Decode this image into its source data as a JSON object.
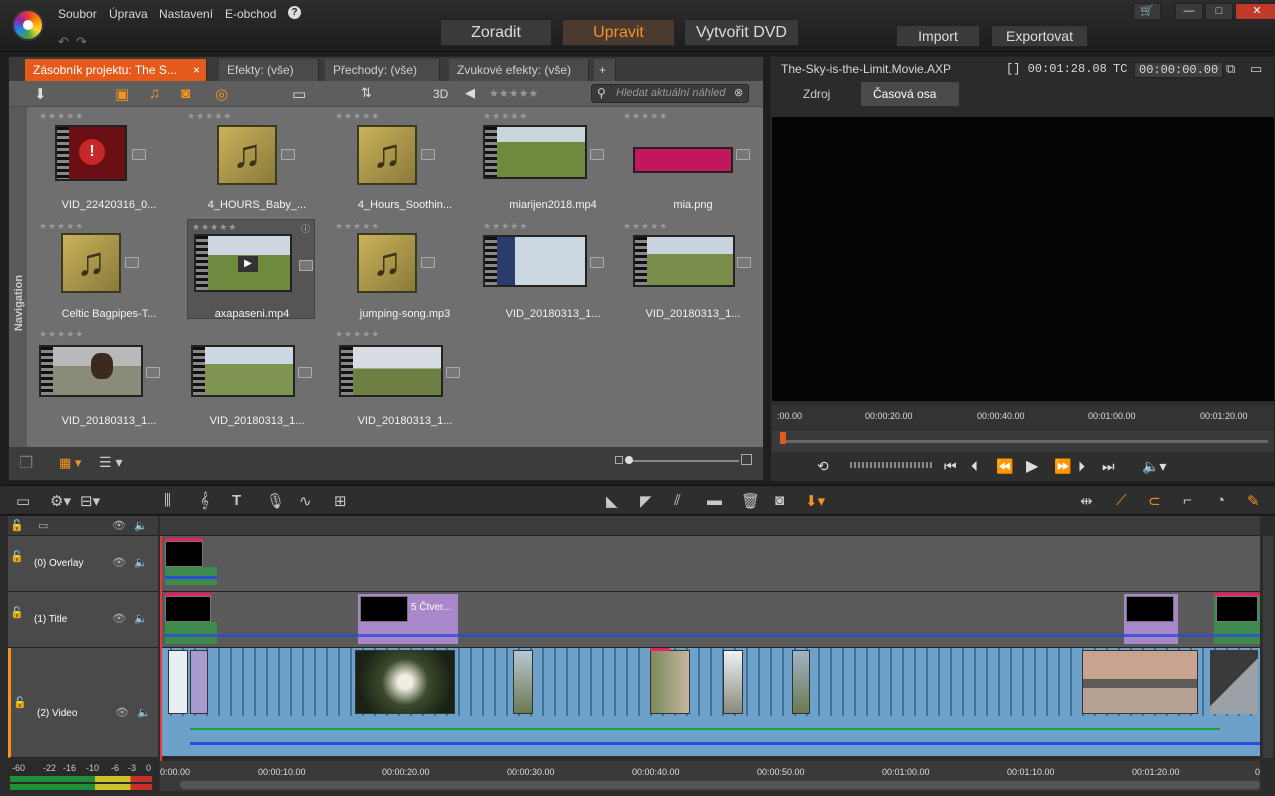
{
  "menu": {
    "items": [
      "Soubor",
      "Úprava",
      "Nastavení",
      "E-obchod"
    ]
  },
  "modes": {
    "organize": "Zoradit",
    "edit": "Upravit",
    "dvd": "Vytvořit DVD",
    "import": "Import",
    "export": "Exportovat"
  },
  "accent": "#f5931f",
  "library": {
    "tabs": [
      "Zásobník projektu: The S...",
      "Efekty: (vše)",
      "Přechody: (vše)",
      "Zvukové efekty: (vše)"
    ],
    "search_placeholder": "Hledat aktuální náhled",
    "toolbar_3d": "3D",
    "nav_label": "Navigation",
    "items": [
      {
        "name": "VID_22420316_0...",
        "type": "video"
      },
      {
        "name": "4_HOURS_Baby_...",
        "type": "music"
      },
      {
        "name": "4_Hours_Soothin...",
        "type": "music"
      },
      {
        "name": "miarijen2018.mp4",
        "type": "video"
      },
      {
        "name": "mia.png",
        "type": "image"
      },
      {
        "name": "Celtic Bagpipes-T...",
        "type": "music"
      },
      {
        "name": "axapaseni.mp4",
        "type": "video"
      },
      {
        "name": "jumping-song.mp3",
        "type": "music"
      },
      {
        "name": "VID_20180313_1...",
        "type": "video"
      },
      {
        "name": "VID_20180313_1...",
        "type": "video"
      },
      {
        "name": "VID_20180313_1...",
        "type": "video"
      },
      {
        "name": "VID_20180313_1...",
        "type": "video"
      },
      {
        "name": "VID_20180313_1...",
        "type": "video"
      }
    ]
  },
  "preview": {
    "title": "The-Sky-is-the-Limit.Movie.AXP",
    "duration_label": "[] 00:01:28.08",
    "tc_label": "TC",
    "tc_value": "00:00:00.00",
    "tabs": [
      "Zdroj",
      "Časová osa"
    ],
    "ruler": [
      ":00.00",
      "00:00:20.00",
      "00:00:40.00",
      "00:01:00.00",
      "00:01:20.00"
    ]
  },
  "timeline": {
    "tracks": [
      {
        "name": "(0) Overlay"
      },
      {
        "name": "(1) Title"
      },
      {
        "name": "(2) Video"
      }
    ],
    "title_clip_label": "5 Čtver...",
    "ruler": [
      "0:00.00",
      "00:00:10.00",
      "00:00:20.00",
      "00:00:30.00",
      "00:00:40.00",
      "00:00:50.00",
      "00:01:00.00",
      "00:01:10.00",
      "00:01:20.00",
      "0"
    ],
    "vu_labels": [
      "-60",
      "-22",
      "-16",
      "-10",
      "-6",
      "-3",
      "0"
    ]
  }
}
